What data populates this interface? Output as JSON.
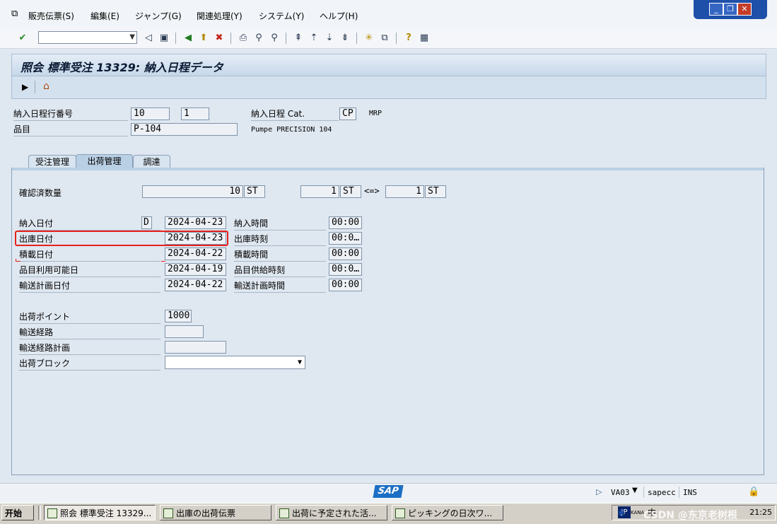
{
  "menu": {
    "items": [
      "販売伝票(S)",
      "編集(E)",
      "ジャンプ(G)",
      "関連処理(Y)",
      "システム(Y)",
      "ヘルプ(H)"
    ]
  },
  "window_controls": {
    "minimize": "_",
    "restore": "❐",
    "close": "✕"
  },
  "toolbar": {
    "command_value": ""
  },
  "title": "照会 標準受注 13329: 納入日程データ",
  "header": {
    "schedule_line_label": "納入日程行番号",
    "item_no": "10",
    "schedule_line_no": "1",
    "schedule_cat_label": "納入日程 Cat.",
    "schedule_cat_value": "CP",
    "schedule_cat_desc": "MRP",
    "material_label": "品目",
    "material_value": "P-104",
    "material_desc": "Pumpe PRECISION 104"
  },
  "tabs": [
    "受注管理",
    "出荷管理",
    "調達"
  ],
  "active_tab": 1,
  "shipping": {
    "confirmed_qty_label": "確認済数量",
    "confirmed_qty": "10",
    "confirmed_unit": "ST",
    "conv_qty1": "1",
    "conv_unit1": "ST",
    "conv_symbol": "<=>",
    "conv_qty2": "1",
    "conv_unit2": "ST",
    "delivery_date_label": "納入日付",
    "date_format": "D",
    "delivery_date": "2024-04-23",
    "delivery_time_label": "納入時間",
    "delivery_time": "00:00",
    "goods_issue_date_label": "出庫日付",
    "goods_issue_date": "2024-04-23",
    "goods_issue_time_label": "出庫時刻",
    "goods_issue_time": "00:0…",
    "loading_date_label": "積載日付",
    "loading_date": "2024-04-22",
    "loading_time_label": "積載時間",
    "loading_time": "00:00",
    "mat_avail_date_label": "品目利用可能日",
    "mat_avail_date": "2024-04-19",
    "mat_staging_time_label": "品目供給時刻",
    "mat_staging_time": "00:0…",
    "transport_plan_date_label": "輸送計画日付",
    "transport_plan_date": "2024-04-22",
    "transport_plan_time_label": "輸送計画時間",
    "transport_plan_time": "00:00",
    "shipping_point_label": "出荷ポイント",
    "shipping_point": "1000",
    "route_label": "輸送経路",
    "route": "",
    "route_schedule_label": "輸送経路計画",
    "route_schedule": "",
    "delivery_block_label": "出荷ブロック",
    "delivery_block": ""
  },
  "status": {
    "tcode": "VA03",
    "server": "sapecc",
    "mode": "INS"
  },
  "taskbar": {
    "start": "开始",
    "tasks": [
      "照会 標準受注 13329...",
      "出庫の出荷伝票",
      "出荷に予定された活...",
      "ピッキングの日次ワ..."
    ],
    "ime": "JP",
    "ime2": "中",
    "kana": "KANA",
    "watermark": "CSDN @东京老树根",
    "clock": "21:25"
  },
  "colors": {
    "highlight": "#e8201c",
    "sap_blue": "#1c6fc4",
    "title_text": "#0b1a33"
  }
}
